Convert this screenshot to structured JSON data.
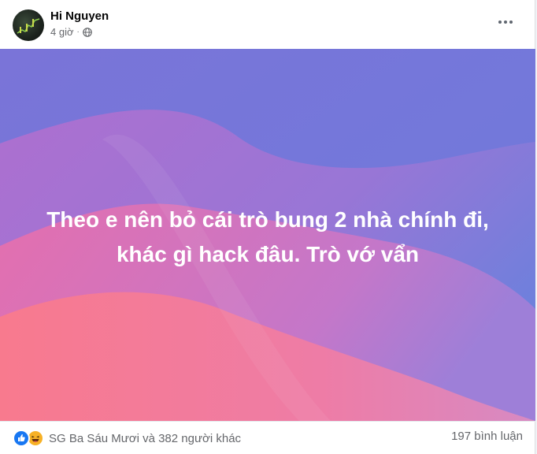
{
  "post": {
    "author": "Hi Nguyen",
    "time": "4 giờ",
    "separator": "·",
    "privacy_icon": "globe-icon",
    "more_icon": "more-options-icon",
    "text_line1": "Theo e nên bỏ cái trò bung 2 nhà chính đi,",
    "text_line2": "khác gì hack đâu. Trò vớ vẩn",
    "background_colors": {
      "top": "#6f7fd8",
      "mid": "#9a72cf",
      "bottom": "#f07a9a"
    }
  },
  "footer": {
    "reactions_label": "SG Ba Sáu Mươi và 382 người khác",
    "reaction_icons": [
      "like-icon",
      "haha-icon"
    ],
    "comments_label": "197 bình luận"
  }
}
